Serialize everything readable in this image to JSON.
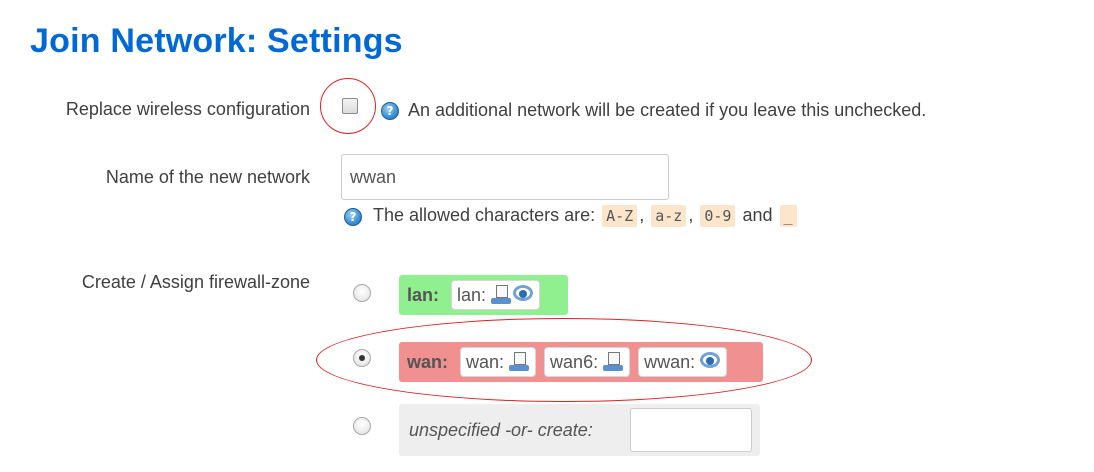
{
  "page": {
    "title": "Join Network: Settings"
  },
  "replace": {
    "label": "Replace wireless configuration",
    "help": "An additional network will be created if you leave this unchecked.",
    "checked": false
  },
  "network_name": {
    "label": "Name of the new network",
    "value": "wwan",
    "help_prefix": "The allowed characters are:",
    "chars": [
      "A-Z",
      "a-z",
      "0-9",
      "_"
    ],
    "sep1": ",",
    "sep2": ",",
    "and_word": "and"
  },
  "firewall": {
    "label": "Create / Assign firewall-zone",
    "zones": [
      {
        "name": "lan:",
        "color": "#90f090",
        "selected": false,
        "interfaces": [
          {
            "name": "lan:",
            "icons": [
              "ethernet-icon",
              "wifi-icon"
            ]
          }
        ]
      },
      {
        "name": "wan:",
        "color": "#f09090",
        "selected": true,
        "interfaces": [
          {
            "name": "wan:",
            "icons": [
              "ethernet-icon"
            ]
          },
          {
            "name": "wan6:",
            "icons": [
              "ethernet-icon"
            ]
          },
          {
            "name": "wwan:",
            "icons": [
              "wifi-icon"
            ]
          }
        ]
      },
      {
        "name": "unspecified -or- create:",
        "color": "#eeeeee",
        "selected": false,
        "interfaces": []
      }
    ]
  },
  "annotation_color": "#e02020"
}
